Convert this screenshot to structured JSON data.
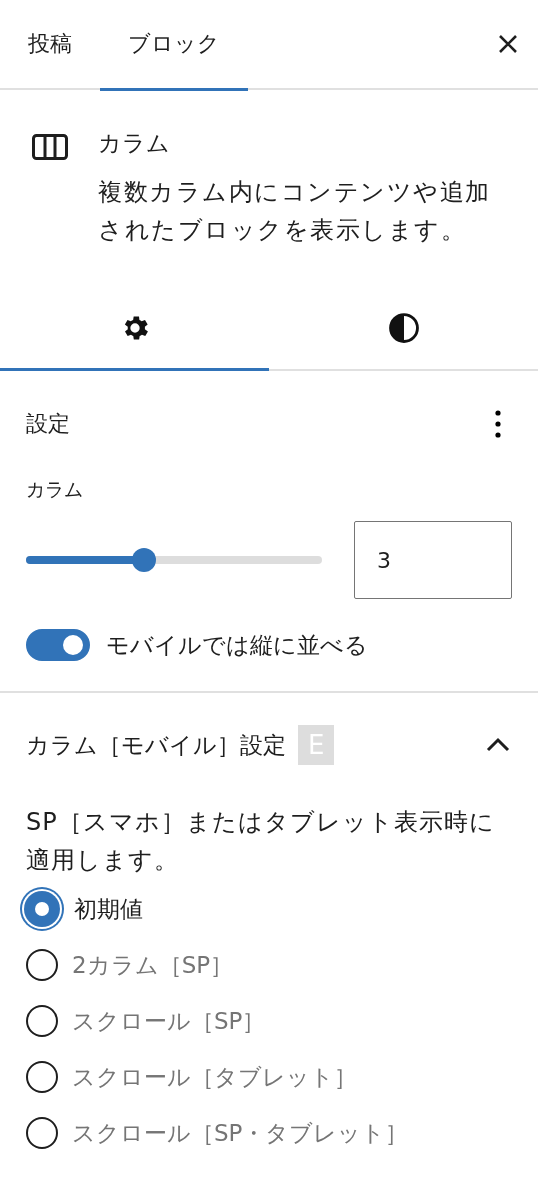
{
  "top_tabs": [
    {
      "label": "投稿",
      "selected": false
    },
    {
      "label": "ブロック",
      "selected": true
    }
  ],
  "block": {
    "title": "カラム",
    "description": "複数カラム内にコンテンツや追加されたブロックを表示します。"
  },
  "sub_tabs": [
    {
      "kind": "settings",
      "selected": true
    },
    {
      "kind": "styles",
      "selected": false
    }
  ],
  "settings_panel": {
    "title": "設定",
    "columns_label": "カラム",
    "slider": {
      "level": 0.4
    },
    "columns_value": "3",
    "toggle": {
      "label": "モバイルでは縦に並べる",
      "on": true
    }
  },
  "mobile_panel": {
    "title": "カラム［モバイル］設定",
    "badge": "E",
    "expanded": true,
    "description": "SP［スマホ］またはタブレット表示時に適用します。",
    "options": [
      {
        "label": "初期値",
        "selected": true
      },
      {
        "label": "2カラム［SP］",
        "selected": false
      },
      {
        "label": "スクロール［SP］",
        "selected": false
      },
      {
        "label": "スクロール［タブレット］",
        "selected": false
      },
      {
        "label": "スクロール［SP・タブレット］",
        "selected": false
      }
    ]
  }
}
